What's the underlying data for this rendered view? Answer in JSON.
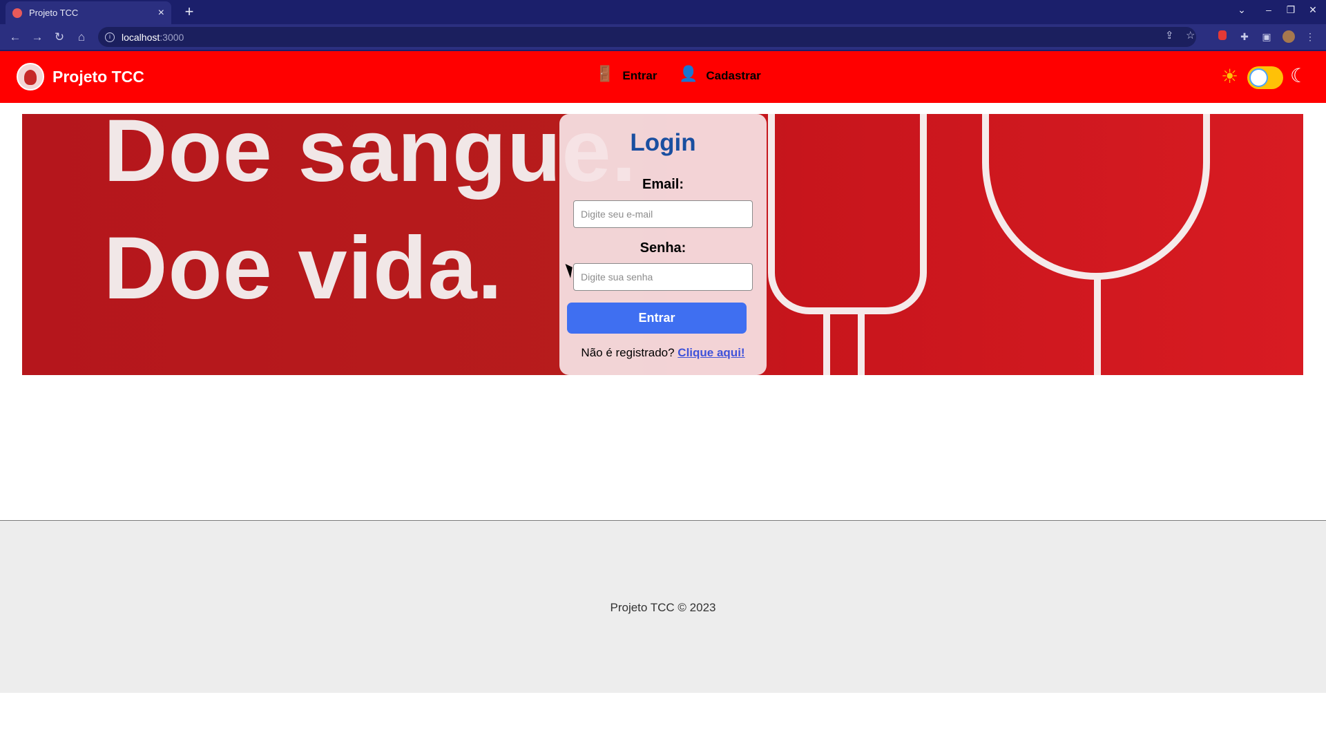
{
  "browser": {
    "tab_title": "Projeto TCC",
    "tab_close": "×",
    "new_tab": "+",
    "url_host": "localhost",
    "url_port": ":3000",
    "back": "←",
    "forward": "→",
    "reload": "↻",
    "home": "⌂",
    "share": "⇪",
    "bookmark": "☆",
    "minimize": "–",
    "restore": "❐",
    "close": "✕",
    "menu": "⋮",
    "tab_list": "⌄"
  },
  "header": {
    "brand": "Projeto TCC",
    "nav": {
      "entrar_label": "Entrar",
      "cadastrar_label": "Cadastrar"
    },
    "theme": {
      "sun_icon": "☀",
      "moon_icon": "☾",
      "light_color": "#ffc107"
    },
    "background_color": "#ff0000"
  },
  "banner": {
    "line1": "Doe sangue.",
    "line2": "Doe vida."
  },
  "login": {
    "title": "Login",
    "email_label": "Email:",
    "email_placeholder": "Digite seu e-mail",
    "email_value": "",
    "password_label": "Senha:",
    "password_placeholder": "Digite sua senha",
    "password_value": "",
    "submit_label": "Entrar",
    "register_prompt": "Não é registrado?",
    "register_link": "Clique aqui!",
    "accent_color": "#3f6ff1",
    "title_color": "#1a4fa0"
  },
  "footer": {
    "text": "Projeto TCC © 2023"
  }
}
